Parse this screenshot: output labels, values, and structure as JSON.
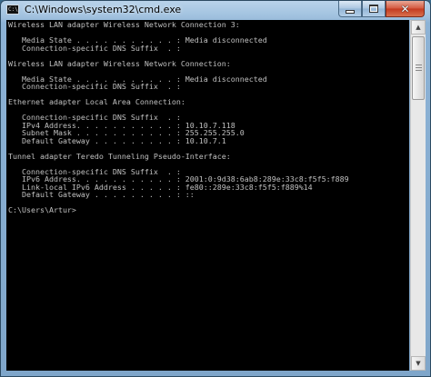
{
  "window": {
    "title": "C:\\Windows\\system32\\cmd.exe",
    "app_icon_text": "C:\\",
    "close_symbol": "✕"
  },
  "console": {
    "lines": [
      "Wireless LAN adapter Wireless Network Connection 3:",
      "",
      "   Media State . . . . . . . . . . . : Media disconnected",
      "   Connection-specific DNS Suffix  . :",
      "",
      "Wireless LAN adapter Wireless Network Connection:",
      "",
      "   Media State . . . . . . . . . . . : Media disconnected",
      "   Connection-specific DNS Suffix  . :",
      "",
      "Ethernet adapter Local Area Connection:",
      "",
      "   Connection-specific DNS Suffix  . :",
      "   IPv4 Address. . . . . . . . . . . : 10.10.7.118",
      "   Subnet Mask . . . . . . . . . . . : 255.255.255.0",
      "   Default Gateway . . . . . . . . . : 10.10.7.1",
      "",
      "Tunnel adapter Teredo Tunneling Pseudo-Interface:",
      "",
      "   Connection-specific DNS Suffix  . :",
      "   IPv6 Address. . . . . . . . . . . : 2001:0:9d38:6ab8:289e:33c8:f5f5:f889",
      "   Link-local IPv6 Address . . . . . : fe80::289e:33c8:f5f5:f889%14",
      "   Default Gateway . . . . . . . . . : ::",
      "",
      "C:\\Users\\Artur>"
    ]
  },
  "colors": {
    "console_background": "#000000",
    "console_text": "#c0c0c0",
    "close_button": "#c8452a"
  },
  "icons": {
    "minimize": "minimize-icon",
    "maximize": "maximize-icon",
    "close": "close-icon",
    "scroll_up": "scroll-up-arrow-icon",
    "scroll_down": "scroll-down-arrow-icon"
  }
}
